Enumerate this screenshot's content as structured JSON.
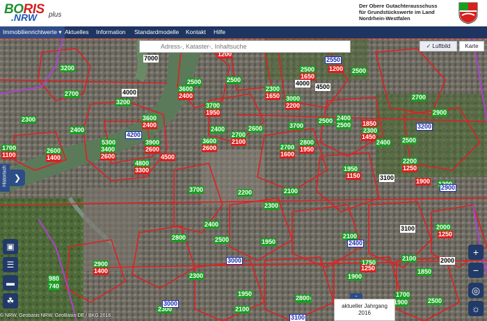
{
  "header": {
    "logo_part1": "BO",
    "logo_part2": "RIS",
    "logo_part3": ".NRW",
    "logo_suffix": "plus",
    "authority_lines": [
      "Der Obere Gutachterausschuss",
      "für Grundstückswerte im Land",
      "Nordrhein-Westfalen"
    ],
    "crest_icon": "nrw-coat-of-arms-icon"
  },
  "nav": {
    "items": [
      "Immobilienrichtwerte ▾",
      "Aktuelles",
      "Information",
      "Standardmodelle",
      "Kontakt",
      "Hilfe"
    ]
  },
  "map": {
    "search_placeholder": "Adress-, Kataster-, Inhaltsuche",
    "btn_luftbild": "✓ Luftbild",
    "btn_karte": "Karte",
    "historisch_label": "Historisch",
    "copyright": "© NRW, Geobasis NRW, GeoBasis-DE / BKG 2016",
    "year_label": "aktueller Jahrgang",
    "year_value": "2016",
    "colors": {
      "green": "#1a9e22",
      "red": "#d8201e",
      "blue": "#1b2aa8",
      "boundary": "#e02020",
      "city_border": "#b040d0"
    },
    "labels": [
      {
        "t": "3200",
        "c": "g"
      },
      {
        "t": "2700",
        "c": "g"
      },
      {
        "t": "4000",
        "c": "k"
      },
      {
        "t": "3200",
        "c": "g"
      },
      {
        "t": "7000",
        "c": "k"
      },
      {
        "t": "1200",
        "c": "r"
      },
      {
        "t": "2500",
        "c": "g"
      },
      {
        "t": "3600",
        "c": "g"
      },
      {
        "t": "2400",
        "c": "r"
      },
      {
        "t": "2500",
        "c": "g"
      },
      {
        "t": "2300",
        "c": "g"
      },
      {
        "t": "2400",
        "c": "g"
      },
      {
        "t": "3600",
        "c": "g"
      },
      {
        "t": "2400",
        "c": "r"
      },
      {
        "t": "4200",
        "c": "b"
      },
      {
        "t": "5300",
        "c": "g"
      },
      {
        "t": "3400",
        "c": "g"
      },
      {
        "t": "2600",
        "c": "r"
      },
      {
        "t": "3900",
        "c": "g"
      },
      {
        "t": "2600",
        "c": "r"
      },
      {
        "t": "4500",
        "c": "r"
      },
      {
        "t": "1700",
        "c": "g"
      },
      {
        "t": "1100",
        "c": "r"
      },
      {
        "t": "2600",
        "c": "g"
      },
      {
        "t": "1400",
        "c": "r"
      },
      {
        "t": "4800",
        "c": "g"
      },
      {
        "t": "3300",
        "c": "r"
      },
      {
        "t": "3700",
        "c": "g"
      },
      {
        "t": "1950",
        "c": "r"
      },
      {
        "t": "2400",
        "c": "g"
      },
      {
        "t": "2700",
        "c": "g"
      },
      {
        "t": "2100",
        "c": "r"
      },
      {
        "t": "2600",
        "c": "g"
      },
      {
        "t": "3600",
        "c": "g"
      },
      {
        "t": "2600",
        "c": "r"
      },
      {
        "t": "2300",
        "c": "g"
      },
      {
        "t": "1650",
        "c": "r"
      },
      {
        "t": "3000",
        "c": "g"
      },
      {
        "t": "2200",
        "c": "r"
      },
      {
        "t": "2500",
        "c": "g"
      },
      {
        "t": "1650",
        "c": "r"
      },
      {
        "t": "4000",
        "c": "k"
      },
      {
        "t": "4500",
        "c": "k"
      },
      {
        "t": "2550",
        "c": "b"
      },
      {
        "t": "1200",
        "c": "r"
      },
      {
        "t": "2500",
        "c": "g"
      },
      {
        "t": "3700",
        "c": "g"
      },
      {
        "t": "2500",
        "c": "g"
      },
      {
        "t": "2700",
        "c": "g"
      },
      {
        "t": "1600",
        "c": "r"
      },
      {
        "t": "2800",
        "c": "g"
      },
      {
        "t": "1950",
        "c": "r"
      },
      {
        "t": "2400",
        "c": "g"
      },
      {
        "t": "2500",
        "c": "g"
      },
      {
        "t": "1850",
        "c": "r"
      },
      {
        "t": "2300",
        "c": "g"
      },
      {
        "t": "1450",
        "c": "r"
      },
      {
        "t": "2700",
        "c": "g"
      },
      {
        "t": "2900",
        "c": "g"
      },
      {
        "t": "3200",
        "c": "b"
      },
      {
        "t": "2500",
        "c": "g"
      },
      {
        "t": "2400",
        "c": "g"
      },
      {
        "t": "2200",
        "c": "g"
      },
      {
        "t": "1250",
        "c": "r"
      },
      {
        "t": "1950",
        "c": "g"
      },
      {
        "t": "1150",
        "c": "r"
      },
      {
        "t": "3100",
        "c": "k"
      },
      {
        "t": "1900",
        "c": "r"
      },
      {
        "t": "1200",
        "c": "g"
      },
      {
        "t": "2900",
        "c": "b"
      },
      {
        "t": "3700",
        "c": "g"
      },
      {
        "t": "2200",
        "c": "g"
      },
      {
        "t": "2100",
        "c": "g"
      },
      {
        "t": "2300",
        "c": "g"
      },
      {
        "t": "2400",
        "c": "g"
      },
      {
        "t": "3100",
        "c": "k"
      },
      {
        "t": "2000",
        "c": "g"
      },
      {
        "t": "1250",
        "c": "r"
      },
      {
        "t": "2800",
        "c": "g"
      },
      {
        "t": "2500",
        "c": "g"
      },
      {
        "t": "1950",
        "c": "g"
      },
      {
        "t": "2100",
        "c": "g"
      },
      {
        "t": "2400",
        "c": "b"
      },
      {
        "t": "3000",
        "c": "b"
      },
      {
        "t": "1750",
        "c": "g"
      },
      {
        "t": "1250",
        "c": "r"
      },
      {
        "t": "2100",
        "c": "g"
      },
      {
        "t": "1900",
        "c": "g"
      },
      {
        "t": "2000",
        "c": "k"
      },
      {
        "t": "2900",
        "c": "g"
      },
      {
        "t": "1400",
        "c": "r"
      },
      {
        "t": "1850",
        "c": "g"
      },
      {
        "t": "980",
        "c": "g"
      },
      {
        "t": "740",
        "c": "g"
      },
      {
        "t": "2300",
        "c": "g"
      },
      {
        "t": "1700",
        "c": "g"
      },
      {
        "t": "2300",
        "c": "g"
      },
      {
        "t": "2100",
        "c": "g"
      },
      {
        "t": "2100",
        "c": "g"
      },
      {
        "t": "2800",
        "c": "g"
      },
      {
        "t": "3000",
        "c": "b"
      },
      {
        "t": "1900",
        "c": "g"
      },
      {
        "t": "2500",
        "c": "g"
      },
      {
        "t": "1950",
        "c": "g"
      },
      {
        "t": "3100",
        "c": "b"
      }
    ]
  }
}
